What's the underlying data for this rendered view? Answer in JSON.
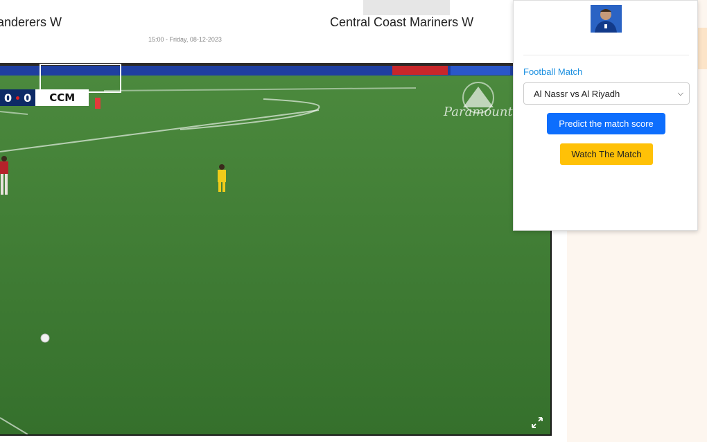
{
  "match": {
    "home_team": "anderers W",
    "away_team": "Central Coast Mariners W",
    "kickoff": "15:00 - Friday, 08-12-2023"
  },
  "video": {
    "scorebug": {
      "home_score": "0",
      "away_score": "0",
      "team_code": "CCM"
    },
    "broadcaster": "Paramount+",
    "fullscreen_icon": "expand-icon"
  },
  "popup": {
    "section_label": "Football Match",
    "selected_match": "Al Nassr vs Al Riyadh",
    "predict_button": "Predict the match score",
    "watch_button": "Watch The Match"
  },
  "colors": {
    "primary": "#0d6efd",
    "warning": "#ffc107",
    "link": "#1a8fe0",
    "pitch": "#3f7a35"
  }
}
